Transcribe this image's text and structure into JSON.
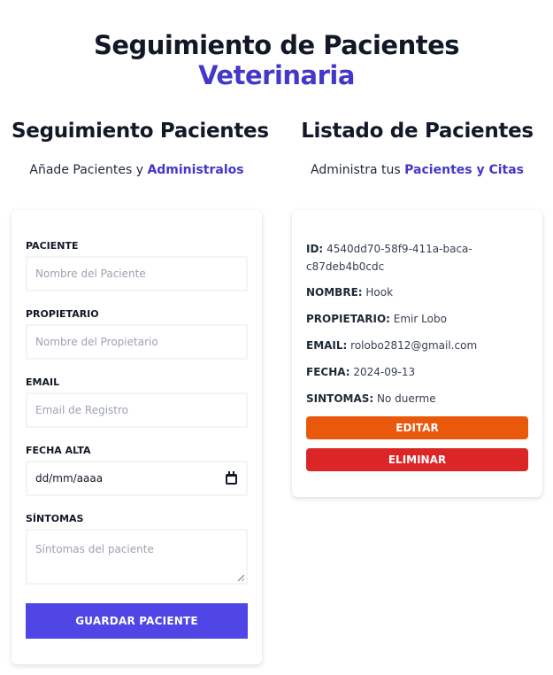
{
  "header": {
    "title": "Seguimiento de Pacientes",
    "title_accent": "Veterinaria"
  },
  "form_section": {
    "title": "Seguimiento Pacientes",
    "subtitle_prefix": "Añade Pacientes y ",
    "subtitle_accent": "Administralos",
    "fields": {
      "patient": {
        "label": "PACIENTE",
        "placeholder": "Nombre del Paciente"
      },
      "owner": {
        "label": "PROPIETARIO",
        "placeholder": "Nombre del Propietario"
      },
      "email": {
        "label": "EMAIL",
        "placeholder": "Email de Registro"
      },
      "date": {
        "label": "FECHA ALTA",
        "value": "dd/mm/aaaa"
      },
      "symptoms": {
        "label": "SÍNTOMAS",
        "placeholder": "Síntomas del paciente"
      }
    },
    "submit_label": "GUARDAR PACIENTE"
  },
  "list_section": {
    "title": "Listado de Pacientes",
    "subtitle_prefix": "Administra tus ",
    "subtitle_accent": "Pacientes y Citas",
    "patient": {
      "id_key": "ID:",
      "id_value": "4540dd70-58f9-411a-baca-c87deb4b0cdc",
      "name_key": "NOMBRE:",
      "name_value": "Hook",
      "owner_key": "PROPIETARIO:",
      "owner_value": "Emir Lobo",
      "email_key": "EMAIL:",
      "email_value": "rolobo2812@gmail.com",
      "date_key": "FECHA:",
      "date_value": "2024-09-13",
      "symptoms_key": "SINTOMAS:",
      "symptoms_value": "No duerme"
    },
    "edit_label": "EDITAR",
    "delete_label": "ELIMINAR"
  },
  "colors": {
    "accent": "#4338ca",
    "primary_button": "#4f46e5",
    "edit_button": "#ea580c",
    "delete_button": "#dc2626"
  },
  "icons": {
    "date_picker": "calendar-icon",
    "textarea_resize": "resize-grip-icon"
  }
}
